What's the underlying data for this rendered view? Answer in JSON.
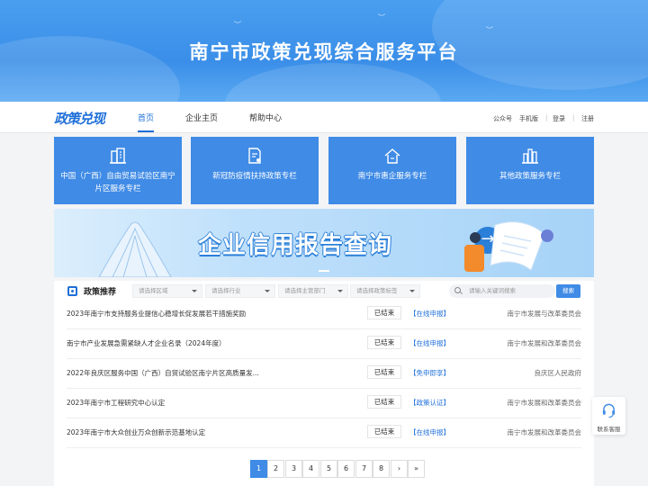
{
  "hero": {
    "title": "南宁市政策兑现综合服务平台"
  },
  "nav": {
    "logo": "政策兑现",
    "items": [
      "首页",
      "企业主页",
      "帮助中心"
    ],
    "active_index": 0,
    "right_links": [
      "公众号",
      "手机版",
      "登录",
      "注册"
    ]
  },
  "cards": [
    {
      "icon": "building-icon",
      "label": "中国（广西）自由贸易试验区南宁片区服务专栏"
    },
    {
      "icon": "document-icon",
      "label": "新冠防疫情扶持政策专栏"
    },
    {
      "icon": "home-icon",
      "label": "南宁市惠企服务专栏"
    },
    {
      "icon": "city-icon",
      "label": "其他政策服务专栏"
    }
  ],
  "banner": {
    "text": "企业信用报告查询"
  },
  "recommend": {
    "title": "政策推荐",
    "filters": [
      "请选择区域",
      "请选择行业",
      "请选择主管部门",
      "请选择政策标签"
    ],
    "search_placeholder": "请输入关键词搜索",
    "search_button": "搜索"
  },
  "policies": [
    {
      "name": "2023年南宁市支持服务业提信心稳增长促发展若干措施奖励",
      "status": "已结束",
      "action": "【在线申报】",
      "dept": "南宁市发展与改革委员会"
    },
    {
      "name": "南宁市产业发展急需紧缺人才企业名录（2024年度）",
      "status": "已结束",
      "action": "【在线申报】",
      "dept": "南宁市发展和改革委员会"
    },
    {
      "name": "2022年良庆区服务中国（广西）自贸试验区南宁片区高质量发...",
      "status": "已结束",
      "action": "【免申即享】",
      "dept": "良庆区人民政府"
    },
    {
      "name": "2023年南宁市工程研究中心认定",
      "status": "已结束",
      "action": "【政策认证】",
      "dept": "南宁市发展和改革委员会"
    },
    {
      "name": "2023年南宁市大众创业万众创新示范基地认定",
      "status": "已结束",
      "action": "【在线申报】",
      "dept": "南宁市发展和改革委员会"
    }
  ],
  "pagination": {
    "pages": [
      "1",
      "2",
      "3",
      "4",
      "5",
      "6",
      "7",
      "8",
      "›",
      "»"
    ],
    "current": "1"
  },
  "float_service": {
    "label": "联系客服"
  },
  "colors": {
    "primary": "#3f8be6",
    "accent": "#1e6fd9"
  }
}
